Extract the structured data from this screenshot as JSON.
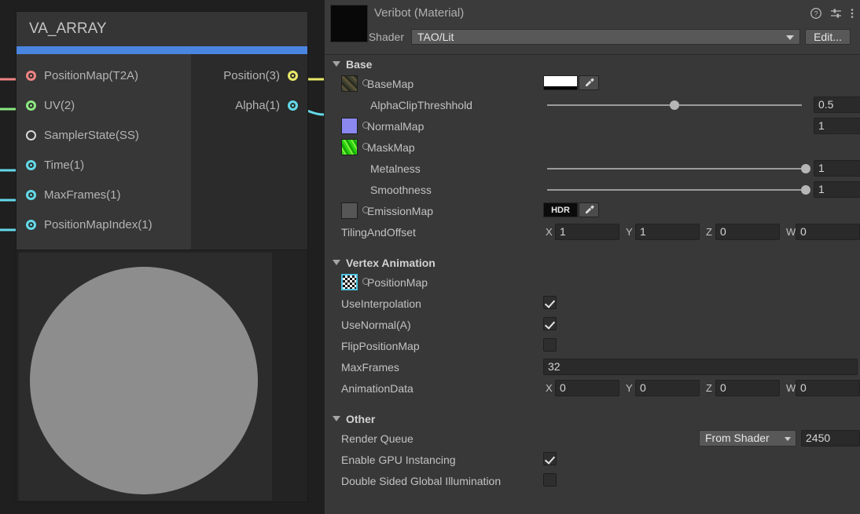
{
  "graph": {
    "node": {
      "title": "VA_ARRAY",
      "accent_color": "#4a85e0",
      "inputs": [
        {
          "label": "PositionMap(T2A)",
          "color": "#ef8383",
          "connected": true,
          "filled": true
        },
        {
          "label": "UV(2)",
          "color": "#8ae87f",
          "connected": true,
          "filled": true
        },
        {
          "label": "SamplerState(SS)",
          "color": "#d8d8d8",
          "connected": false,
          "filled": false
        },
        {
          "label": "Time(1)",
          "color": "#63d9e8",
          "connected": true,
          "filled": true
        },
        {
          "label": "MaxFrames(1)",
          "color": "#63d9e8",
          "connected": true,
          "filled": true
        },
        {
          "label": "PositionMapIndex(1)",
          "color": "#63d9e8",
          "connected": true,
          "filled": true
        }
      ],
      "outputs": [
        {
          "label": "Position(3)",
          "color": "#e8e86a",
          "connected": true,
          "filled": true
        },
        {
          "label": "Alpha(1)",
          "color": "#63d9e8",
          "connected": true,
          "filled": true
        }
      ]
    },
    "preview": {
      "sphere_color": "#8d8d8d",
      "background_color": "#2c2c2c"
    }
  },
  "inspector": {
    "title": "Veribot (Material)",
    "icons": {
      "help": "?",
      "preset": "preset-icon",
      "menu": "⋮"
    },
    "shader": {
      "label": "Shader",
      "value": "TAO/Lit",
      "edit_label": "Edit..."
    },
    "sections": {
      "base": {
        "title": "Base",
        "base_map": {
          "label": "BaseMap",
          "swatch_color": "#ffffff",
          "thumb_color": "#4a4833"
        },
        "alpha_clip": {
          "label": "AlphaClipThreshhold",
          "value": "0.5",
          "slider_percent": 50
        },
        "normal_map": {
          "label": "NormalMap",
          "thumb_color": "#8b88f0",
          "scale_value": "1"
        },
        "mask_map": {
          "label": "MaskMap",
          "thumb_color": "#38e018"
        },
        "metalness": {
          "label": "Metalness",
          "value": "1",
          "slider_percent": 100
        },
        "smoothness": {
          "label": "Smoothness",
          "value": "1",
          "slider_percent": 100
        },
        "emission_map": {
          "label": "EmissionMap",
          "swatch_label": "HDR",
          "thumb_color": "#565656"
        },
        "tiling_offset": {
          "label": "TilingAndOffset",
          "axes": [
            "X",
            "Y",
            "Z",
            "W"
          ],
          "values": [
            "1",
            "1",
            "0",
            "0"
          ]
        }
      },
      "vertex_animation": {
        "title": "Vertex Animation",
        "position_map": {
          "label": "PositionMap"
        },
        "use_interpolation": {
          "label": "UseInterpolation",
          "checked": true
        },
        "use_normal": {
          "label": "UseNormal(A)",
          "checked": true
        },
        "flip_position_map": {
          "label": "FlipPositionMap",
          "checked": false
        },
        "max_frames": {
          "label": "MaxFrames",
          "value": "32"
        },
        "animation_data": {
          "label": "AnimationData",
          "axes": [
            "X",
            "Y",
            "Z",
            "W"
          ],
          "values": [
            "0",
            "0",
            "0",
            "0"
          ]
        }
      },
      "other": {
        "title": "Other",
        "render_queue": {
          "label": "Render Queue",
          "mode": "From Shader",
          "value": "2450"
        },
        "gpu_instancing": {
          "label": "Enable GPU Instancing",
          "checked": true
        },
        "double_sided_gi": {
          "label": "Double Sided Global Illumination",
          "checked": false
        }
      }
    }
  }
}
